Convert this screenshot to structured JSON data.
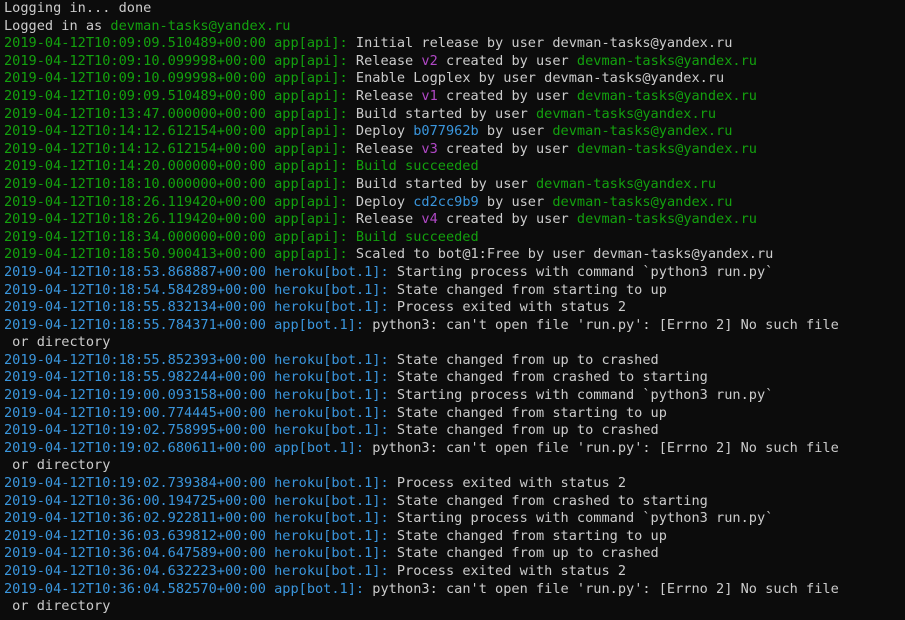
{
  "window": {
    "title": ""
  },
  "colors": {
    "default": "#cccccc",
    "green": "#13a10e",
    "cyan": "#3a96dd",
    "magenta": "#b148c6",
    "background": "#0c0c0c"
  },
  "lines": [
    [
      {
        "t": "Logging in... done",
        "c": "default"
      }
    ],
    [
      {
        "t": "Logged in as ",
        "c": "default"
      },
      {
        "t": "devman-tasks@yandex.ru",
        "c": "green"
      }
    ],
    [
      {
        "t": "2019-04-12T10:09:09.510489+00:00 app[api]: ",
        "c": "green"
      },
      {
        "t": "Initial release by user devman-tasks@yandex.ru",
        "c": "default"
      }
    ],
    [
      {
        "t": "2019-04-12T10:09:10.099998+00:00 app[api]: ",
        "c": "green"
      },
      {
        "t": "Release ",
        "c": "default"
      },
      {
        "t": "v2",
        "c": "magenta"
      },
      {
        "t": " created by user ",
        "c": "default"
      },
      {
        "t": "devman-tasks@yandex.ru",
        "c": "green"
      }
    ],
    [
      {
        "t": "2019-04-12T10:09:10.099998+00:00 app[api]: ",
        "c": "green"
      },
      {
        "t": "Enable Logplex by user devman-tasks@yandex.ru",
        "c": "default"
      }
    ],
    [
      {
        "t": "2019-04-12T10:09:09.510489+00:00 app[api]: ",
        "c": "green"
      },
      {
        "t": "Release ",
        "c": "default"
      },
      {
        "t": "v1",
        "c": "magenta"
      },
      {
        "t": " created by user ",
        "c": "default"
      },
      {
        "t": "devman-tasks@yandex.ru",
        "c": "green"
      }
    ],
    [
      {
        "t": "2019-04-12T10:13:47.000000+00:00 app[api]: ",
        "c": "green"
      },
      {
        "t": "Build started by user ",
        "c": "default"
      },
      {
        "t": "devman-tasks@yandex.ru",
        "c": "green"
      }
    ],
    [
      {
        "t": "2019-04-12T10:14:12.612154+00:00 app[api]: ",
        "c": "green"
      },
      {
        "t": "Deploy ",
        "c": "default"
      },
      {
        "t": "b077962b",
        "c": "cyan"
      },
      {
        "t": " by user ",
        "c": "default"
      },
      {
        "t": "devman-tasks@yandex.ru",
        "c": "green"
      }
    ],
    [
      {
        "t": "2019-04-12T10:14:12.612154+00:00 app[api]: ",
        "c": "green"
      },
      {
        "t": "Release ",
        "c": "default"
      },
      {
        "t": "v3",
        "c": "magenta"
      },
      {
        "t": " created by user ",
        "c": "default"
      },
      {
        "t": "devman-tasks@yandex.ru",
        "c": "green"
      }
    ],
    [
      {
        "t": "2019-04-12T10:14:20.000000+00:00 app[api]: Build succeeded",
        "c": "green"
      }
    ],
    [
      {
        "t": "2019-04-12T10:18:10.000000+00:00 app[api]: ",
        "c": "green"
      },
      {
        "t": "Build started by user ",
        "c": "default"
      },
      {
        "t": "devman-tasks@yandex.ru",
        "c": "green"
      }
    ],
    [
      {
        "t": "2019-04-12T10:18:26.119420+00:00 app[api]: ",
        "c": "green"
      },
      {
        "t": "Deploy ",
        "c": "default"
      },
      {
        "t": "cd2cc9b9",
        "c": "cyan"
      },
      {
        "t": " by user ",
        "c": "default"
      },
      {
        "t": "devman-tasks@yandex.ru",
        "c": "green"
      }
    ],
    [
      {
        "t": "2019-04-12T10:18:26.119420+00:00 app[api]: ",
        "c": "green"
      },
      {
        "t": "Release ",
        "c": "default"
      },
      {
        "t": "v4",
        "c": "magenta"
      },
      {
        "t": " created by user ",
        "c": "default"
      },
      {
        "t": "devman-tasks@yandex.ru",
        "c": "green"
      }
    ],
    [
      {
        "t": "2019-04-12T10:18:34.000000+00:00 app[api]: Build succeeded",
        "c": "green"
      }
    ],
    [
      {
        "t": "2019-04-12T10:18:50.900413+00:00 app[api]: ",
        "c": "green"
      },
      {
        "t": "Scaled to bot@1:Free by user devman-tasks@yandex.ru",
        "c": "default"
      }
    ],
    [
      {
        "t": "2019-04-12T10:18:53.868887+00:00 heroku[bot.1]: ",
        "c": "cyan"
      },
      {
        "t": "Starting process with command `python3 run.py`",
        "c": "default"
      }
    ],
    [
      {
        "t": "2019-04-12T10:18:54.584289+00:00 heroku[bot.1]: ",
        "c": "cyan"
      },
      {
        "t": "State changed from starting to up",
        "c": "default"
      }
    ],
    [
      {
        "t": "2019-04-12T10:18:55.832134+00:00 heroku[bot.1]: ",
        "c": "cyan"
      },
      {
        "t": "Process exited with status 2",
        "c": "default"
      }
    ],
    [
      {
        "t": "2019-04-12T10:18:55.784371+00:00 app[bot.1]: ",
        "c": "cyan"
      },
      {
        "t": "python3: can't open file 'run.py': [Errno 2] No such file",
        "c": "default"
      }
    ],
    [
      {
        "t": " or directory",
        "c": "default"
      }
    ],
    [
      {
        "t": "2019-04-12T10:18:55.852393+00:00 heroku[bot.1]: ",
        "c": "cyan"
      },
      {
        "t": "State changed from up to crashed",
        "c": "default"
      }
    ],
    [
      {
        "t": "2019-04-12T10:18:55.982244+00:00 heroku[bot.1]: ",
        "c": "cyan"
      },
      {
        "t": "State changed from crashed to starting",
        "c": "default"
      }
    ],
    [
      {
        "t": "2019-04-12T10:19:00.093158+00:00 heroku[bot.1]: ",
        "c": "cyan"
      },
      {
        "t": "Starting process with command `python3 run.py`",
        "c": "default"
      }
    ],
    [
      {
        "t": "2019-04-12T10:19:00.774445+00:00 heroku[bot.1]: ",
        "c": "cyan"
      },
      {
        "t": "State changed from starting to up",
        "c": "default"
      }
    ],
    [
      {
        "t": "2019-04-12T10:19:02.758995+00:00 heroku[bot.1]: ",
        "c": "cyan"
      },
      {
        "t": "State changed from up to crashed",
        "c": "default"
      }
    ],
    [
      {
        "t": "2019-04-12T10:19:02.680611+00:00 app[bot.1]: ",
        "c": "cyan"
      },
      {
        "t": "python3: can't open file 'run.py': [Errno 2] No such file",
        "c": "default"
      }
    ],
    [
      {
        "t": " or directory",
        "c": "default"
      }
    ],
    [
      {
        "t": "2019-04-12T10:19:02.739384+00:00 heroku[bot.1]: ",
        "c": "cyan"
      },
      {
        "t": "Process exited with status 2",
        "c": "default"
      }
    ],
    [
      {
        "t": "2019-04-12T10:36:00.194725+00:00 heroku[bot.1]: ",
        "c": "cyan"
      },
      {
        "t": "State changed from crashed to starting",
        "c": "default"
      }
    ],
    [
      {
        "t": "2019-04-12T10:36:02.922811+00:00 heroku[bot.1]: ",
        "c": "cyan"
      },
      {
        "t": "Starting process with command `python3 run.py`",
        "c": "default"
      }
    ],
    [
      {
        "t": "2019-04-12T10:36:03.639812+00:00 heroku[bot.1]: ",
        "c": "cyan"
      },
      {
        "t": "State changed from starting to up",
        "c": "default"
      }
    ],
    [
      {
        "t": "2019-04-12T10:36:04.647589+00:00 heroku[bot.1]: ",
        "c": "cyan"
      },
      {
        "t": "State changed from up to crashed",
        "c": "default"
      }
    ],
    [
      {
        "t": "2019-04-12T10:36:04.632223+00:00 heroku[bot.1]: ",
        "c": "cyan"
      },
      {
        "t": "Process exited with status 2",
        "c": "default"
      }
    ],
    [
      {
        "t": "2019-04-12T10:36:04.582570+00:00 app[bot.1]: ",
        "c": "cyan"
      },
      {
        "t": "python3: can't open file 'run.py': [Errno 2] No such file",
        "c": "default"
      }
    ],
    [
      {
        "t": " or directory",
        "c": "default"
      }
    ]
  ]
}
